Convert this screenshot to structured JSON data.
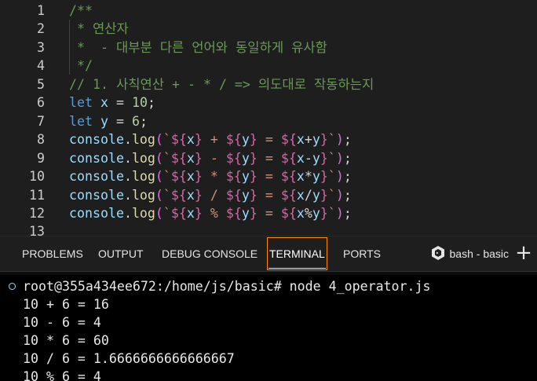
{
  "editor": {
    "lines": [
      {
        "n": "1",
        "t": "/**"
      },
      {
        "n": "2",
        "t": " * 연산자"
      },
      {
        "n": "3",
        "t": " *  - 대부분 다른 언어와 동일하게 유사함"
      },
      {
        "n": "4",
        "t": " */"
      },
      {
        "n": "5",
        "t": "// 1. 사칙연산 + - * / => 의도대로 작동하는지"
      },
      {
        "n": "6",
        "t": "let x = 10;"
      },
      {
        "n": "7",
        "t": "let y = 6;"
      },
      {
        "n": "8",
        "t": "console.log(`${x} + ${y} = ${x+y}`);"
      },
      {
        "n": "9",
        "t": "console.log(`${x} - ${y} = ${x-y}`);"
      },
      {
        "n": "10",
        "t": "console.log(`${x} * ${y} = ${x*y}`);"
      },
      {
        "n": "11",
        "t": "console.log(`${x} / ${y} = ${x/y}`);"
      },
      {
        "n": "12",
        "t": "console.log(`${x} % ${y} = ${x%y}`);"
      },
      {
        "n": "13",
        "t": ""
      }
    ]
  },
  "panel": {
    "tabs": [
      "PROBLEMS",
      "OUTPUT",
      "DEBUG CONSOLE",
      "TERMINAL",
      "PORTS"
    ],
    "active_tab": "TERMINAL",
    "terminal_name": "bash - basic",
    "terminal_icon": "bash-terminal-icon",
    "add_icon": "plus-icon"
  },
  "terminal": {
    "prompt": "root@355a434ee672:/home/js/basic# node 4_operator.js",
    "output": [
      "10 + 6 = 16",
      "10 - 6 = 4",
      "10 * 6 = 60",
      "10 / 6 = 1.6666666666666667",
      "10 % 6 = 4"
    ]
  },
  "colors": {
    "comment": "#6a9955",
    "keyword": "#569cd6",
    "variable": "#9cdcfe",
    "function": "#dcdcaa",
    "number": "#b5cea8",
    "string": "#ce9178",
    "active_tab_border": "#ff8c00"
  }
}
